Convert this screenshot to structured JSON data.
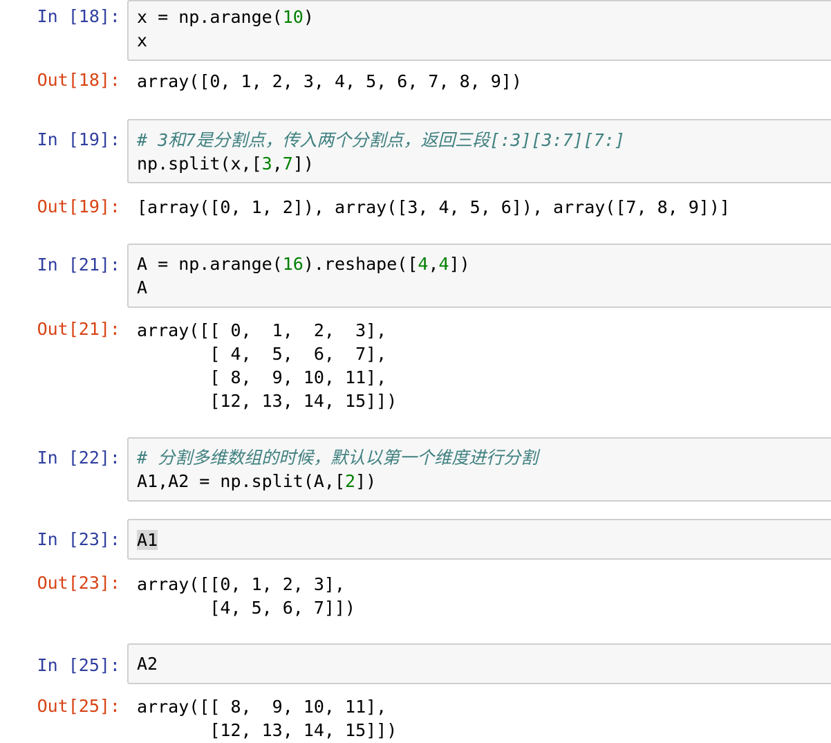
{
  "cells": [
    {
      "in_prompt": "In [18]:",
      "code": [
        [
          {
            "t": "x = np.arange("
          },
          {
            "t": "10",
            "c": "num"
          },
          {
            "t": ")"
          }
        ],
        [
          {
            "t": "x"
          }
        ]
      ],
      "out_prompt": "Out[18]:",
      "output": "array([0, 1, 2, 3, 4, 5, 6, 7, 8, 9])"
    },
    {
      "in_prompt": "In [19]:",
      "code": [
        [
          {
            "t": "# 3和7是分割点，传入两个分割点，返回三段[:3][3:7][7:]",
            "c": "comment"
          }
        ],
        [
          {
            "t": "np.split(x,["
          },
          {
            "t": "3",
            "c": "num"
          },
          {
            "t": ","
          },
          {
            "t": "7",
            "c": "num"
          },
          {
            "t": "])"
          }
        ]
      ],
      "out_prompt": "Out[19]:",
      "output": "[array([0, 1, 2]), array([3, 4, 5, 6]), array([7, 8, 9])]"
    },
    {
      "in_prompt": "In [21]:",
      "code": [
        [
          {
            "t": "A = np.arange("
          },
          {
            "t": "16",
            "c": "num"
          },
          {
            "t": ").reshape(["
          },
          {
            "t": "4",
            "c": "num"
          },
          {
            "t": ","
          },
          {
            "t": "4",
            "c": "num"
          },
          {
            "t": "])"
          }
        ],
        [
          {
            "t": "A"
          }
        ]
      ],
      "out_prompt": "Out[21]:",
      "output": "array([[ 0,  1,  2,  3],\n       [ 4,  5,  6,  7],\n       [ 8,  9, 10, 11],\n       [12, 13, 14, 15]])"
    },
    {
      "in_prompt": "In [22]:",
      "code": [
        [
          {
            "t": "# 分割多维数组的时候，默认以第一个维度进行分割",
            "c": "comment"
          }
        ],
        [
          {
            "t": "A1,A2 = np.split(A,["
          },
          {
            "t": "2",
            "c": "num"
          },
          {
            "t": "])"
          }
        ]
      ],
      "out_prompt": "",
      "output": ""
    },
    {
      "in_prompt": "In [23]:",
      "code": [
        [
          {
            "t": "A1",
            "c": "sel"
          }
        ]
      ],
      "out_prompt": "Out[23]:",
      "output": "array([[0, 1, 2, 3],\n       [4, 5, 6, 7]])"
    },
    {
      "in_prompt": "In [25]:",
      "code": [
        [
          {
            "t": "A2"
          }
        ]
      ],
      "out_prompt": "Out[25]:",
      "output": "array([[ 8,  9, 10, 11],\n       [12, 13, 14, 15]])"
    }
  ]
}
